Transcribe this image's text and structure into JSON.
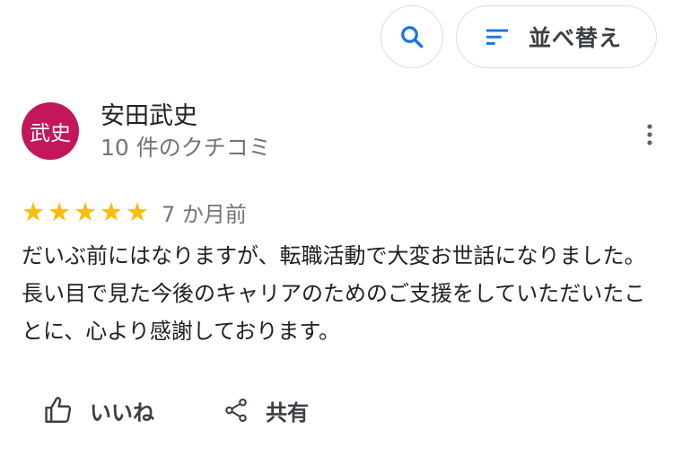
{
  "toolbar": {
    "search_icon": "search-icon",
    "sort_icon": "sort-icon",
    "sort_label": "並べ替え"
  },
  "review": {
    "avatar_text": "武史",
    "avatar_color": "#c2185b",
    "author_name": "安田武史",
    "author_count": "10 件のクチコミ",
    "rating": 5,
    "rating_max": 5,
    "date": "7 か月前",
    "text": "だいぶ前にはなりますが、転職活動で大変お世話になりました。長い目で見た今後のキャリアのためのご支援をしていただいたことに、心より感謝しております。"
  },
  "actions": {
    "like_label": "いいね",
    "share_label": "共有"
  },
  "colors": {
    "accent_blue": "#1a73e8",
    "star": "#fbbc04",
    "secondary_text": "#70757a"
  }
}
